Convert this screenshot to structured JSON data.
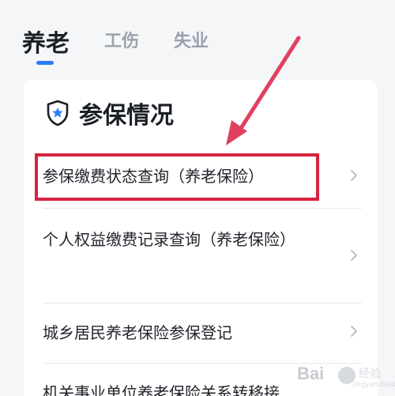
{
  "tabs": [
    {
      "label": "养老",
      "active": true
    },
    {
      "label": "工伤",
      "active": false
    },
    {
      "label": "失业",
      "active": false
    }
  ],
  "section": {
    "title": "参保情况",
    "icon": "shield-star-icon"
  },
  "items": [
    {
      "label": "参保缴费状态查询（养老保险）",
      "highlighted": true
    },
    {
      "label": "个人权益缴费记录查询（养老保险）",
      "highlighted": false
    },
    {
      "label": "城乡居民养老保险参保登记",
      "highlighted": false
    },
    {
      "label": "机关事业单位养老保险关系转移接",
      "highlighted": false
    }
  ],
  "colors": {
    "accent_blue": "#2f7cf6",
    "highlight_red": "#d6233f",
    "arrow_pink": "#e0405e"
  },
  "watermark": {
    "brand": "Bai",
    "suffix": "经验",
    "url": "jingyan.baidu.com"
  }
}
